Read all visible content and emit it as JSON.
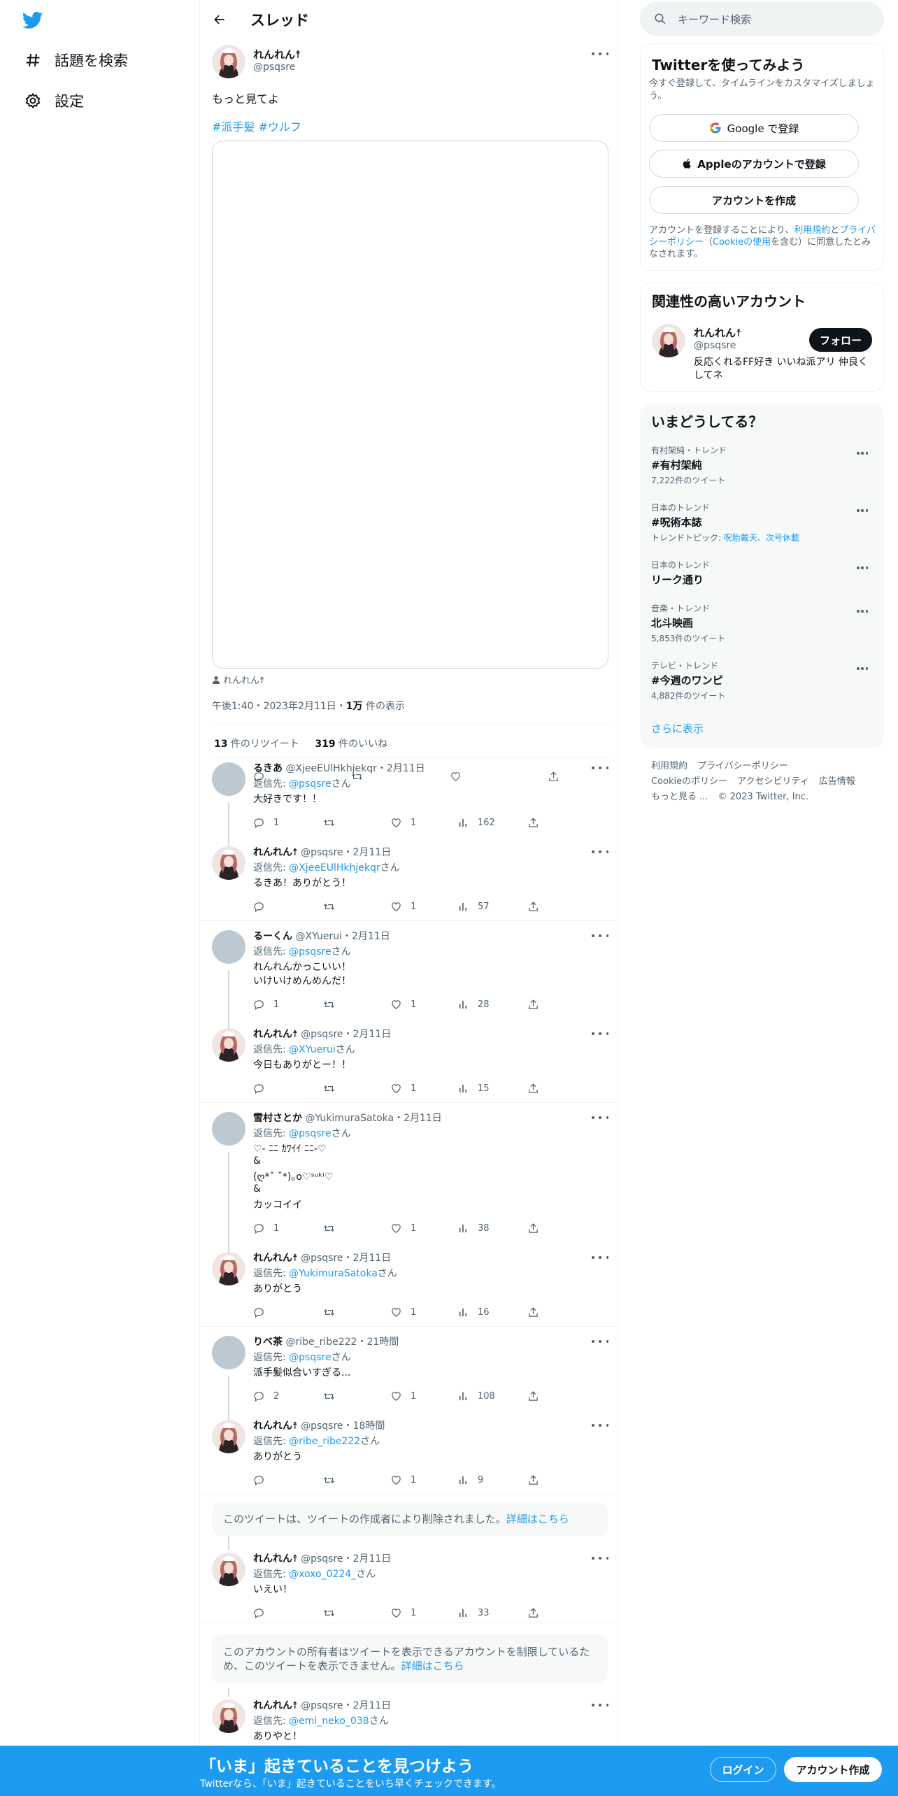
{
  "nav": {
    "explore": "話題を検索",
    "settings": "設定"
  },
  "header": {
    "title": "スレッド"
  },
  "tweet": {
    "name": "れんれん☨",
    "handle": "@psqsre",
    "text": "もっと見てよ",
    "hashtag1": "#派手髪",
    "hashtag2": "#ウルフ",
    "tagged": "れんれん☨",
    "time": "午後1:40・2023年2月11日・",
    "views_num": "1万",
    "views_label": " 件の表示",
    "retweets_num": "13",
    "retweets_label": " 件のリツイート",
    "likes_num": "319",
    "likes_label": " 件のいいね"
  },
  "replies": [
    {
      "name": "るきあ",
      "handle": "@XjeeEUlHkhjekqr",
      "date": "・2月11日",
      "reply_to_label": "返信先: ",
      "reply_to": "@psqsre",
      "san": "さん",
      "lines": [
        "大好きです！！"
      ],
      "reply": "1",
      "rt": "",
      "like": "1",
      "views": "162"
    },
    {
      "name": "れんれん☨",
      "handle": "@psqsre",
      "date": "・2月11日",
      "reply_to_label": "返信先: ",
      "reply_to": "@XjeeEUlHkhjekqr",
      "san": "さん",
      "lines": [
        "るきあ！ありがとう！"
      ],
      "reply": "",
      "rt": "",
      "like": "1",
      "views": "57"
    },
    {
      "name": "るーくん",
      "handle": "@XYuerui",
      "date": "・2月11日",
      "reply_to_label": "返信先: ",
      "reply_to": "@psqsre",
      "san": "さん",
      "lines": [
        "れんれんかっこいい！",
        "いけいけめんめんだ！"
      ],
      "reply": "1",
      "rt": "",
      "like": "1",
      "views": "28"
    },
    {
      "name": "れんれん☨",
      "handle": "@psqsre",
      "date": "・2月11日",
      "reply_to_label": "返信先: ",
      "reply_to": "@XYuerui",
      "san": "さん",
      "lines": [
        "今日もありがとー！！"
      ],
      "reply": "",
      "rt": "",
      "like": "1",
      "views": "15"
    },
    {
      "name": "雪村さとか",
      "handle": "@YukimuraSatoka",
      "date": "・2月11日",
      "reply_to_label": "返信先: ",
      "reply_to": "@psqsre",
      "san": "さん",
      "lines": [
        "♡- ﾆﾆ ｶﾜｲｲ  ﾆﾆ-♡",
        "&",
        "(ღ*ˇ ˇ*)｡o♡ˢᵘᵏⁱ♡",
        "&",
        "カッコイイ"
      ],
      "reply": "1",
      "rt": "",
      "like": "1",
      "views": "38"
    },
    {
      "name": "れんれん☨",
      "handle": "@psqsre",
      "date": "・2月11日",
      "reply_to_label": "返信先: ",
      "reply_to": "@YukimuraSatoka",
      "san": "さん",
      "lines": [
        "ありがとう"
      ],
      "reply": "",
      "rt": "",
      "like": "1",
      "views": "16"
    },
    {
      "name": "りべ茶",
      "handle": "@ribe_ribe222",
      "date": "・21時間",
      "reply_to_label": "返信先: ",
      "reply_to": "@psqsre",
      "san": "さん",
      "lines": [
        "派手髪似合いすぎる..."
      ],
      "reply": "2",
      "rt": "",
      "like": "1",
      "views": "108"
    },
    {
      "name": "れんれん☨",
      "handle": "@psqsre",
      "date": "・18時間",
      "reply_to_label": "返信先: ",
      "reply_to": "@ribe_ribe222",
      "san": "さん",
      "lines": [
        "ありがとう"
      ],
      "reply": "",
      "rt": "",
      "like": "1",
      "views": "9"
    },
    {
      "name": "れんれん☨",
      "handle": "@psqsre",
      "date": "・2月11日",
      "reply_to_label": "返信先: ",
      "reply_to": "@xoxo_0224_",
      "san": "さん",
      "lines": [
        "いえい！"
      ],
      "reply": "",
      "rt": "",
      "like": "1",
      "views": "33"
    },
    {
      "name": "れんれん☨",
      "handle": "@psqsre",
      "date": "・2月11日",
      "reply_to_label": "返信先: ",
      "reply_to": "@emi_neko_038",
      "san": "さん",
      "lines": [
        "ありやと！"
      ],
      "reply": "",
      "rt": "",
      "like": "",
      "views": ""
    }
  ],
  "notice1": {
    "text": "このツイートは、ツイートの作成者により削除されました。",
    "link": "詳細はこちら"
  },
  "notice2": {
    "text": "このアカウントの所有者はツイートを表示できるアカウントを制限しているため、このツイートを表示できません。",
    "link": "詳細はこちら"
  },
  "search": {
    "placeholder": "キーワード検索"
  },
  "signup": {
    "title": "Twitterを使ってみよう",
    "sub": "今すぐ登録して、タイムラインをカスタマイズしましょう。",
    "google": "Google で登録",
    "apple": "Appleのアカウントで登録",
    "create": "アカウントを作成",
    "legal_1": "アカウントを登録することにより、",
    "legal_terms": "利用規約",
    "legal_2": "と",
    "legal_privacy": "プライバシーポリシー",
    "legal_3": "（",
    "legal_cookie": "Cookieの使用",
    "legal_4": "を含む）に同意したとみなされます。"
  },
  "related": {
    "title": "関連性の高いアカウント",
    "name": "れんれん☨",
    "handle": "@psqsre",
    "follow": "フォロー",
    "bio": "反応くれるFF好き いいね派アリ 仲良くしてネ"
  },
  "trends": {
    "title": "いまどうしてる？",
    "items": [
      {
        "context": "有村架純・トレンド",
        "name": "#有村架純",
        "meta": "7,222件のツイート"
      },
      {
        "context": "日本のトレンド",
        "name": "#呪術本誌",
        "meta_prefix": "トレンドトピック: ",
        "meta": "呪胎戴天、次号休載"
      },
      {
        "context": "日本のトレンド",
        "name": "リーク通り",
        "meta": ""
      },
      {
        "context": "音楽・トレンド",
        "name": "北斗映画",
        "meta": "5,853件のツイート"
      },
      {
        "context": "テレビ・トレンド",
        "name": "#今週のワンピ",
        "meta": "4,882件のツイート"
      }
    ],
    "more": "さらに表示"
  },
  "footer": {
    "terms": "利用規約",
    "privacy": "プライバシーポリシー",
    "cookie": "Cookieのポリシー",
    "access": "アクセシビリティ",
    "ads": "広告情報",
    "more": "もっと見る ...",
    "copy": "© 2023 Twitter, Inc."
  },
  "bottom": {
    "title": "「いま」起きていることを見つけよう",
    "sub": "Twitterなら、「いま」起きていることをいち早くチェックできます。",
    "login": "ログイン",
    "signup": "アカウント作成"
  },
  "colors": {
    "accent": "#1d9bf0",
    "text": "#0f1419",
    "muted": "#536471"
  }
}
